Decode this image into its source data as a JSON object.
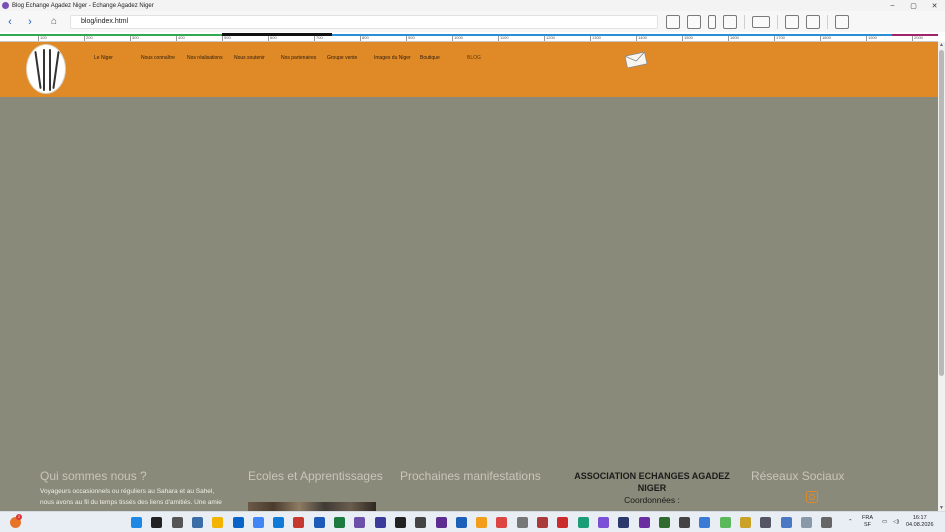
{
  "window": {
    "title": "Blog Echange Agadez Niger - Echange Agadez Niger",
    "minimize": "–",
    "maximize": "▢",
    "close": "✕"
  },
  "toolbar": {
    "back": "‹",
    "forward": "›",
    "home": "⌂",
    "address": "blog/index.html",
    "icons": [
      "edit-icon",
      "pen-icon",
      "phone-icon",
      "tablet-icon",
      "monitor-icon",
      "resize-icon",
      "copy-icon",
      "inspect-icon"
    ]
  },
  "ruler": {
    "labels": [
      "100",
      "200",
      "300",
      "400",
      "500",
      "600",
      "700",
      "800",
      "900",
      "1000",
      "1100",
      "1200",
      "1300",
      "1400",
      "1500",
      "1600",
      "1700",
      "1800",
      "1900",
      "2000"
    ]
  },
  "site": {
    "menu": [
      {
        "label": "Le Niger"
      },
      {
        "label": "Nous connaître"
      },
      {
        "label": "Nos réalisations"
      },
      {
        "label": "Nous soutenir"
      },
      {
        "label": "Nos partenaires"
      },
      {
        "label": "Groupe vente"
      },
      {
        "label": "Images du Niger"
      },
      {
        "label": "Boutique"
      },
      {
        "label": "BLOG"
      }
    ],
    "colors": {
      "header": "#e08a27",
      "content": "#8a8a7a"
    }
  },
  "footer": {
    "about": {
      "heading": "Qui sommes nous ?",
      "text_line1": "Voyageurs occasionnels ou réguliers au Sahara et au Sahel,",
      "text_line2": "nous avons au fil du temps tissés des liens d'amitiés. Une amie"
    },
    "schools": {
      "heading": "Ecoles et Apprentissages"
    },
    "events": {
      "heading": "Prochaines manifestations"
    },
    "association": {
      "name_line1": "ASSOCIATION ECHANGES AGADEZ",
      "name_line2": "NIGER",
      "coord": "Coordonnées :"
    },
    "social": {
      "heading": "Réseaux Sociaux"
    }
  },
  "taskbar": {
    "badge": "2",
    "lang_line1": "FRA",
    "lang_line2": "SF",
    "time": "16:17",
    "date": "04.08.2026"
  }
}
